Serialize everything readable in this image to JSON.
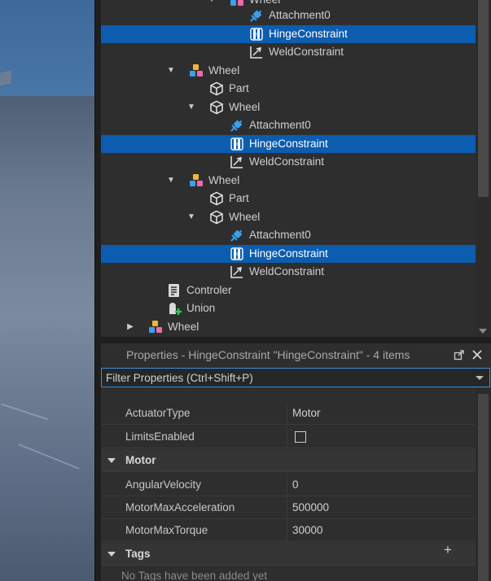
{
  "explorer": {
    "rows": [
      {
        "label": "Wheel",
        "icon": "model-icon",
        "selected": false,
        "arrow": "down"
      },
      {
        "label": "Attachment0",
        "icon": "attachment-icon",
        "selected": false,
        "arrow": ""
      },
      {
        "label": "HingeConstraint",
        "icon": "hinge-constraint-icon",
        "selected": true,
        "arrow": ""
      },
      {
        "label": "WeldConstraint",
        "icon": "weld-constraint-icon",
        "selected": false,
        "arrow": ""
      },
      {
        "label": "Wheel",
        "icon": "model-icon",
        "selected": false,
        "arrow": "down"
      },
      {
        "label": "Part",
        "icon": "part-icon",
        "selected": false,
        "arrow": ""
      },
      {
        "label": "Wheel",
        "icon": "part-icon",
        "selected": false,
        "arrow": "down"
      },
      {
        "label": "Attachment0",
        "icon": "attachment-icon",
        "selected": false,
        "arrow": ""
      },
      {
        "label": "HingeConstraint",
        "icon": "hinge-constraint-icon",
        "selected": true,
        "arrow": ""
      },
      {
        "label": "WeldConstraint",
        "icon": "weld-constraint-icon",
        "selected": false,
        "arrow": ""
      },
      {
        "label": "Wheel",
        "icon": "model-icon",
        "selected": false,
        "arrow": "down"
      },
      {
        "label": "Part",
        "icon": "part-icon",
        "selected": false,
        "arrow": ""
      },
      {
        "label": "Wheel",
        "icon": "part-icon",
        "selected": false,
        "arrow": "down"
      },
      {
        "label": "Attachment0",
        "icon": "attachment-icon",
        "selected": false,
        "arrow": ""
      },
      {
        "label": "HingeConstraint",
        "icon": "hinge-constraint-icon",
        "selected": true,
        "arrow": ""
      },
      {
        "label": "WeldConstraint",
        "icon": "weld-constraint-icon",
        "selected": false,
        "arrow": ""
      },
      {
        "label": "Controler",
        "icon": "script-icon",
        "selected": false,
        "arrow": ""
      },
      {
        "label": "Union",
        "icon": "union-icon",
        "selected": false,
        "arrow": ""
      },
      {
        "label": "Wheel",
        "icon": "model-icon",
        "selected": false,
        "arrow": "right"
      }
    ]
  },
  "properties": {
    "title": "Properties - HingeConstraint \"HingeConstraint\" - 4 items",
    "filter_placeholder": "Filter Properties (Ctrl+Shift+P)",
    "rows": [
      {
        "kind": "prop",
        "name": "ActuatorType",
        "value": "Motor"
      },
      {
        "kind": "check",
        "name": "LimitsEnabled",
        "value": ""
      },
      {
        "kind": "cat",
        "name": "Motor",
        "value": ""
      },
      {
        "kind": "prop",
        "name": "AngularVelocity",
        "value": "0"
      },
      {
        "kind": "prop",
        "name": "MotorMaxAcceleration",
        "value": "500000"
      },
      {
        "kind": "prop",
        "name": "MotorMaxTorque",
        "value": "30000"
      },
      {
        "kind": "cat",
        "name": "Tags",
        "value": ""
      }
    ],
    "tags_empty": "No Tags have been added yet"
  },
  "colors": {
    "selection": "#0c5caf",
    "panel": "#2e2e2e",
    "accent": "#3e8ed6"
  }
}
